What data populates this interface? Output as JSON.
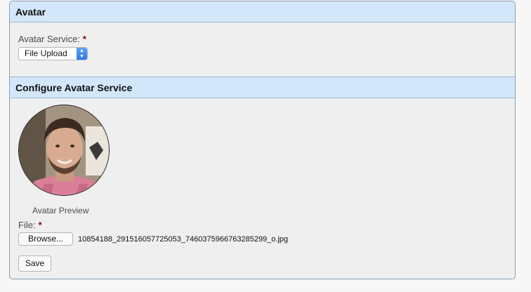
{
  "avatar_section": {
    "title": "Avatar",
    "service_label": "Avatar Service:",
    "required_mark": "*",
    "service_select": {
      "selected": "File Upload",
      "arrow_icon": "updown-chevron-icon"
    }
  },
  "configure_section": {
    "title": "Configure Avatar Service",
    "preview_caption": "Avatar Preview",
    "file_label": "File:",
    "required_mark": "*",
    "browse_label": "Browse...",
    "selected_file": "10854188_291516057725053_7460375966763285299_o.jpg",
    "save_label": "Save"
  },
  "colors": {
    "header_bg": "#d3e7fb",
    "panel_bg": "#efefef",
    "required": "#8b0000",
    "select_accent": "#2f78e3"
  }
}
